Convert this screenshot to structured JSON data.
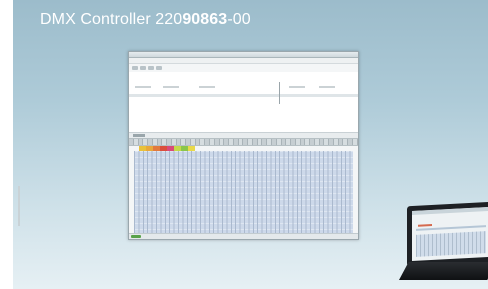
{
  "heading": {
    "prefix": "DMX Controller 220",
    "bold": "90863",
    "suffix": "-00"
  },
  "colors": {
    "panel_top": "#9cbccb",
    "panel_bottom": "#e6f0f4",
    "grid_cells": "#cdd9ea",
    "channel_swatches": [
      "#e9c23b",
      "#e9a83b",
      "#e27a3e",
      "#db4f3c",
      "#d84a7a",
      "#c4d84a",
      "#8ac64a",
      "#e9d94a"
    ]
  },
  "icons": {
    "start": "start-button-icon",
    "toolbar": "toolbar-icon"
  }
}
